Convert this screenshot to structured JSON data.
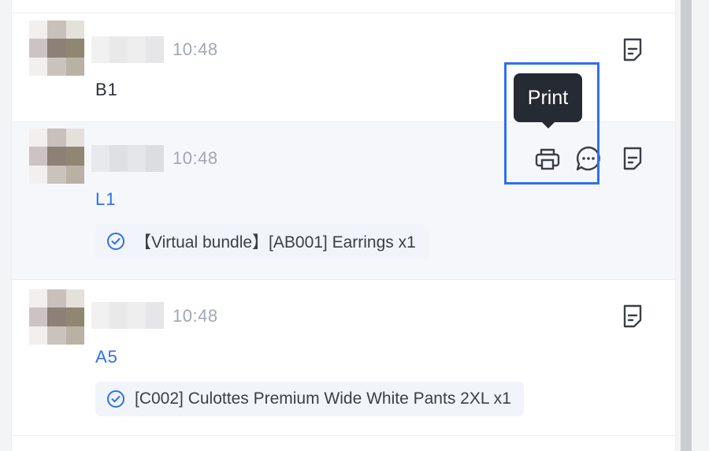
{
  "tooltip": {
    "label": "Print"
  },
  "icons": {
    "note": "note-icon",
    "print": "printer-icon",
    "chat": "chat-bubble-icon",
    "check": "check-circle-icon"
  },
  "colors": {
    "accent": "#2f6ff5",
    "hover_row": "#f5f7fb",
    "pill_bg": "#f1f4fa",
    "tooltip_bg": "#262a32",
    "highlight": "#2f6ff5"
  },
  "rows": [
    {
      "time": "10:48",
      "code": "B1",
      "code_style": "plain",
      "item": ""
    },
    {
      "time": "10:48",
      "code": "L1",
      "code_style": "link",
      "item": "【Virtual bundle】[AB001] Earrings x1"
    },
    {
      "time": "10:48",
      "code": "A5",
      "code_style": "link",
      "item": "[C002] Culottes Premium Wide White Pants 2XL x1"
    }
  ]
}
